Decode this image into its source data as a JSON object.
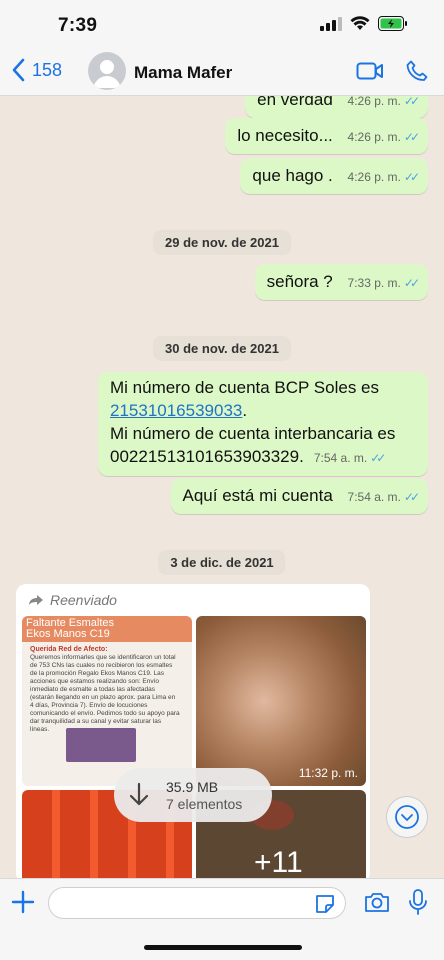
{
  "status_bar": {
    "time": "7:39"
  },
  "nav": {
    "back_count": "158",
    "contact_name": "Mama Mafer"
  },
  "messages": [
    {
      "text": "en verdad",
      "time": "4:26 p. m."
    },
    {
      "text": "lo necesito...",
      "time": "4:26 p. m."
    },
    {
      "text": "que hago .",
      "time": "4:26 p. m."
    },
    {
      "date": "29 de nov. de 2021"
    },
    {
      "text": "señora ?",
      "time": "7:33 p. m."
    },
    {
      "date": "30 de nov. de 2021"
    },
    {
      "line1": "Mi número de cuenta BCP Soles es",
      "link": "21531016539033",
      "line2": "Mi número de cuenta interbancaria es",
      "line3": "00221513101653903329.",
      "time": "7:54 a. m."
    },
    {
      "text": "Aquí está mi cuenta",
      "time": "7:54 a. m."
    },
    {
      "date": "3 de dic. de 2021"
    }
  ],
  "album": {
    "forwarded_label": "Reenviado",
    "doc": {
      "header1": "Faltante Esmaltes",
      "header2": "Ekos Manos C19",
      "heading": "Querida Red de Afecto:",
      "body": "Queremos informarles que se identificaron un total de 753 CNs las cuales no recibieron los esmaltes de la promoción Regalo Ekos Manos C19. Las acciones que estamos realizando son: Envío inmediato de esmalte a todas las afectadas (estarán llegando en un plazo aprox. para Lima en 4 días, Provincia 7). Envío de locuciones comunicando el envío. Pedimos todo su apoyo para dar tranquilidad a su canal y evitar saturar las líneas."
    },
    "photo_time": "11:32 p. m.",
    "download_size": "35.9 MB",
    "download_count": "7 elementos",
    "overlay_text": "+11"
  },
  "input": {
    "placeholder": ""
  },
  "colors": {
    "outgoing": "#dcf8c6",
    "accent": "#1b74e4",
    "read_ticks": "#4fa3e0",
    "background": "#efe7de"
  }
}
